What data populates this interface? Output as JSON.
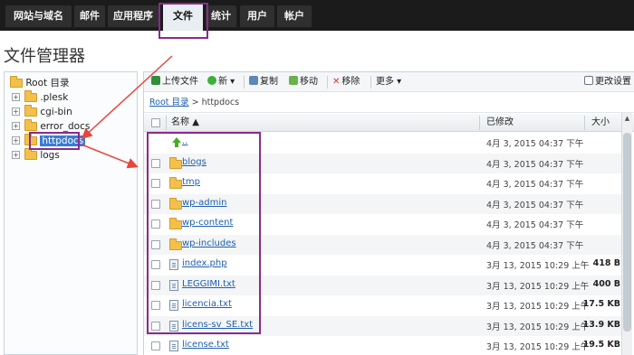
{
  "nav": {
    "tabs": [
      {
        "label": "网站与域名"
      },
      {
        "label": "邮件"
      },
      {
        "label": "应用程序"
      },
      {
        "label": "文件"
      },
      {
        "label": "统计"
      },
      {
        "label": "用户"
      },
      {
        "label": "帐户"
      }
    ]
  },
  "page_title": "文件管理器",
  "tree": {
    "root": "Root 目录",
    "items": [
      {
        "label": ".plesk"
      },
      {
        "label": "cgi-bin"
      },
      {
        "label": "error_docs"
      },
      {
        "label": "httpdocs"
      },
      {
        "label": "logs"
      }
    ]
  },
  "toolbar": {
    "upload": "上传文件",
    "new": "新",
    "copy": "复制",
    "move": "移动",
    "remove": "移除",
    "more": "更多",
    "settings": "更改设置"
  },
  "breadcrumb": {
    "root": "Root 目录",
    "sep": ">",
    "current": "httpdocs"
  },
  "table": {
    "headers": {
      "name": "名称",
      "modified": "已修改",
      "size": "大小"
    },
    "rows": [
      {
        "name": "..",
        "date": "4月 3, 2015 04:37 下午",
        "size": "",
        "type": "up"
      },
      {
        "name": "blogs",
        "date": "4月 3, 2015 04:37 下午",
        "size": "",
        "type": "folder"
      },
      {
        "name": "tmp",
        "date": "4月 3, 2015 04:37 下午",
        "size": "",
        "type": "folder"
      },
      {
        "name": "wp-admin",
        "date": "4月 3, 2015 04:37 下午",
        "size": "",
        "type": "folder"
      },
      {
        "name": "wp-content",
        "date": "4月 3, 2015 04:37 下午",
        "size": "",
        "type": "folder"
      },
      {
        "name": "wp-includes",
        "date": "4月 3, 2015 04:37 下午",
        "size": "",
        "type": "folder"
      },
      {
        "name": "index.php",
        "date": "3月 13, 2015 10:29 上午",
        "size": "418 B",
        "type": "file"
      },
      {
        "name": "LEGGIMI.txt",
        "date": "3月 13, 2015 10:29 上午",
        "size": "400 B",
        "type": "file"
      },
      {
        "name": "licencia.txt",
        "date": "3月 13, 2015 10:29 上午",
        "size": "17.5 KB",
        "type": "file"
      },
      {
        "name": "licens-sv_SE.txt",
        "date": "3月 13, 2015 10:29 上午",
        "size": "13.9 KB",
        "type": "file"
      },
      {
        "name": "license.txt",
        "date": "3月 13, 2015 10:29 上午",
        "size": "19.5 KB",
        "type": "file"
      }
    ]
  },
  "colors": {
    "highlight": "#8a2a8c",
    "arrow": "#e8453c",
    "link": "#1f5fb0"
  }
}
